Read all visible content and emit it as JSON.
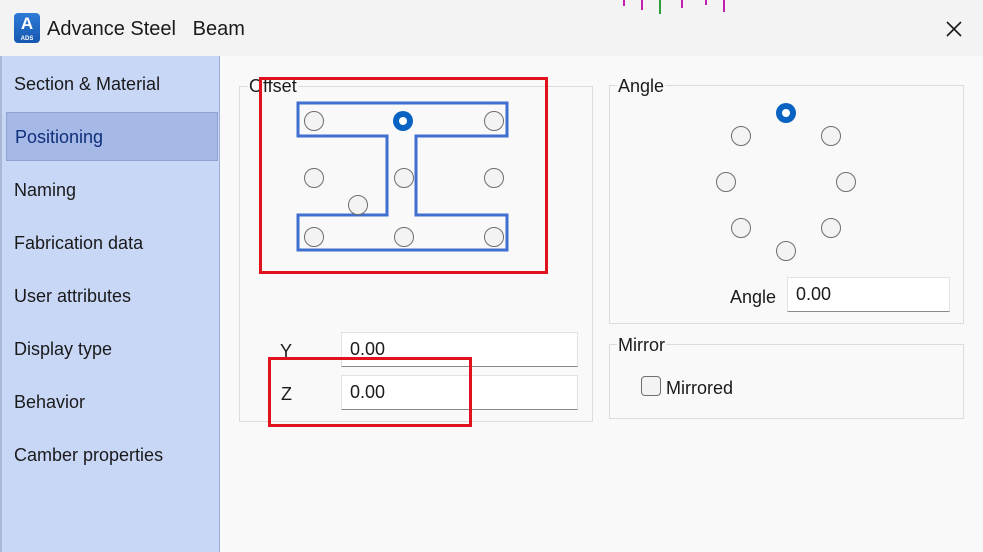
{
  "window": {
    "app_icon_letter": "A",
    "app_icon_caption": "ADS",
    "title": "Advance Steel   Beam",
    "close_icon": "close-icon"
  },
  "sidebar": {
    "items": [
      {
        "label": "Section & Material"
      },
      {
        "label": "Positioning",
        "selected": true
      },
      {
        "label": "Naming"
      },
      {
        "label": "Fabrication data"
      },
      {
        "label": "User attributes"
      },
      {
        "label": "Display type"
      },
      {
        "label": "Behavior"
      },
      {
        "label": "Camber properties"
      }
    ]
  },
  "offset": {
    "label": "Offset",
    "selected_point": "top-center",
    "y_label": "Y",
    "y_value": "0.00",
    "z_label": "Z",
    "z_value": "0.00"
  },
  "angle": {
    "label": "Angle",
    "selected_point": "top",
    "angle_label": "Angle",
    "angle_value": "0.00"
  },
  "mirror": {
    "label": "Mirror",
    "checkbox_label": "Mirrored",
    "checked": false
  },
  "colors": {
    "accent": "#0a62c2",
    "beam_outline": "#3f6fd0",
    "highlight": "#e0121c",
    "sidebar": "#c9d7f7"
  }
}
